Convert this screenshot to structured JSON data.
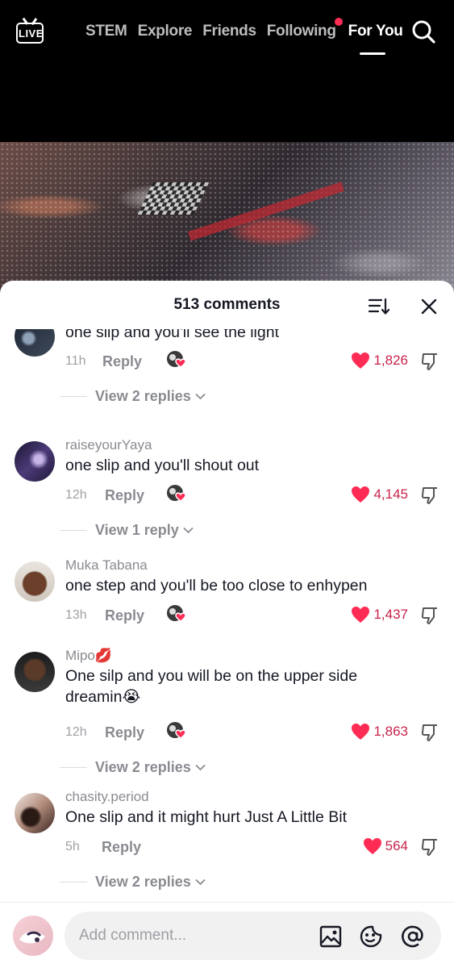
{
  "nav": {
    "live_label": "LIVE",
    "tabs": [
      "STEM",
      "Explore",
      "Friends",
      "Following",
      "For You"
    ],
    "active_tab": "For You",
    "search_icon": "search-icon"
  },
  "comments_header": {
    "title": "513 comments",
    "sort_icon": "sort-icon",
    "close_icon": "close-icon"
  },
  "comments": [
    {
      "username": "",
      "text": "one slip and you'll see the light",
      "time": "11h",
      "reply_label": "Reply",
      "likes": "1,826",
      "replies_label": "View 2 replies"
    },
    {
      "username": "raiseyourYaya",
      "text": "one slip and you'll shout out",
      "time": "12h",
      "reply_label": "Reply",
      "likes": "4,145",
      "replies_label": "View 1 reply"
    },
    {
      "username": "Muka Tabana",
      "text": "one step and you'll be too close to enhypen",
      "time": "13h",
      "reply_label": "Reply",
      "likes": "1,437",
      "replies_label": ""
    },
    {
      "username": "Mipo💋",
      "text": "One silp and you will be on the upper side dreamin😭",
      "time": "12h",
      "reply_label": "Reply",
      "likes": "1,863",
      "replies_label": "View 2 replies"
    },
    {
      "username": "chasity.period",
      "text": "One slip and it might hurt Just A Little Bit",
      "time": "5h",
      "reply_label": "Reply",
      "likes": "564",
      "replies_label": "View 2 replies"
    }
  ],
  "input": {
    "placeholder": "Add comment...",
    "icons": [
      "image-icon",
      "sticker-icon",
      "mention-icon"
    ]
  },
  "colors": {
    "like_red": "#fe2c55",
    "like_count": "#c8224a",
    "text": "#161823",
    "muted": "#8a8b91"
  }
}
